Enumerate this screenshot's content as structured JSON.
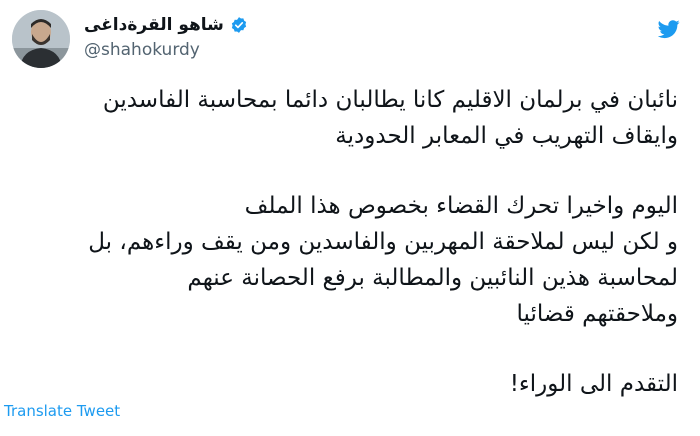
{
  "author": {
    "display_name": "شاهو القرةداغی",
    "handle": "@shahokurdy",
    "verified": true,
    "avatar_icon": "user-avatar-photo"
  },
  "logo_icon": "twitter-bird-icon",
  "accent_color": "#1d9bf0",
  "tweet": {
    "paragraphs": [
      {
        "lines": [
          "نائبان في برلمان الاقليم كانا يطالبان دائما بمحاسبة الفاسدين",
          "وايقاف التهريب في المعابر الحدودية"
        ]
      },
      {
        "lines": [
          "اليوم واخيرا تحرك القضاء بخصوص هذا الملف",
          "و لكن ليس لملاحقة المهربين والفاسدين ومن يقف وراءهم، بل",
          "لمحاسبة هذين النائبين والمطالبة برفع الحصانة عنهم",
          "وملاحقتهم قضائيا"
        ]
      },
      {
        "lines": [
          "التقدم الى الوراء!"
        ]
      }
    ]
  },
  "translate_label": "Translate Tweet"
}
